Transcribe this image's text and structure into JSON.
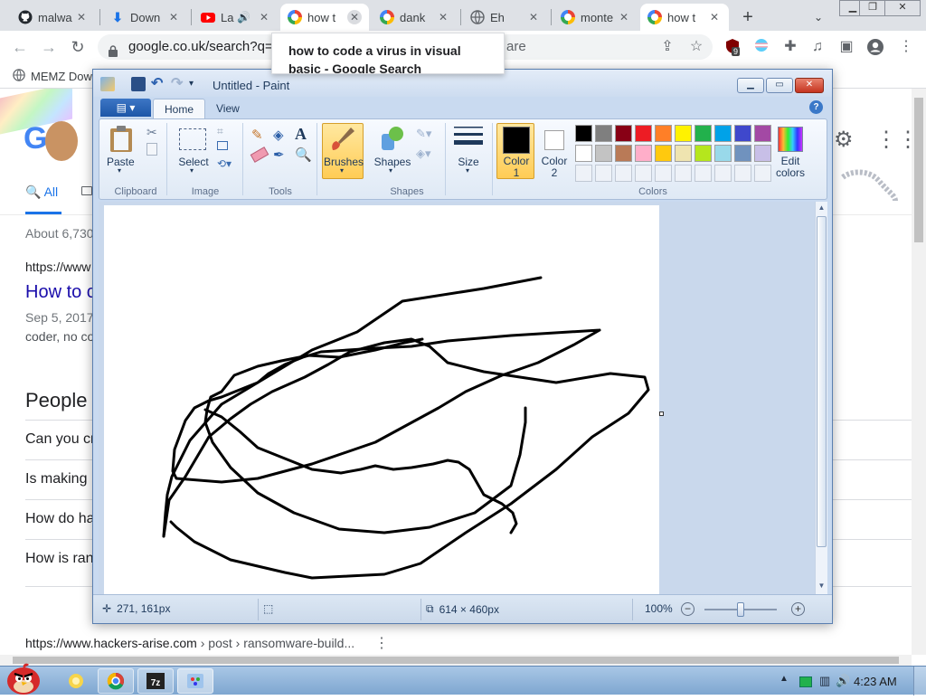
{
  "browser": {
    "tabs": [
      {
        "label": "malwa",
        "icon": "github-icon"
      },
      {
        "label": "Down",
        "icon": "download-icon"
      },
      {
        "label": "La",
        "icon": "youtube-icon"
      },
      {
        "label": "how t",
        "icon": "google-icon",
        "active": true
      },
      {
        "label": "dank",
        "icon": "google-icon"
      },
      {
        "label": "Eh",
        "icon": "globe-icon"
      },
      {
        "label": "monte",
        "icon": "google-icon"
      },
      {
        "label": "how t",
        "icon": "google-icon"
      }
    ],
    "new_tab_label": "+",
    "url": "google.co.uk/search?q=",
    "url_suffix": "are",
    "extension_badge": "9",
    "bookmark": "MEMZ Dow",
    "tooltip_title": "how to code a virus in visual basic - Google Search"
  },
  "google": {
    "logo_text": "Go",
    "tab_all": "All",
    "stats": "About 6,730",
    "result1_url": "https://www",
    "result1_title": "How to c",
    "result1_date": "Sep 5, 2017",
    "result1_snippet": "coder, no co",
    "paa_title": "People a",
    "paa_questions": [
      "Can you cr",
      "Is making",
      "How do ha",
      "How is ran"
    ],
    "result2_url": "https://www.hackers-arise.com",
    "result2_path": " › post › ransomware-build..."
  },
  "paint": {
    "title": "Untitled - Paint",
    "tabs": {
      "home": "Home",
      "view": "View"
    },
    "groups": {
      "clipboard": "Clipboard",
      "image": "Image",
      "tools": "Tools",
      "shapes": "Shapes",
      "colors": "Colors"
    },
    "buttons": {
      "paste": "Paste",
      "select": "Select",
      "brushes": "Brushes",
      "shapes": "Shapes",
      "size": "Size",
      "color1_line1": "Color",
      "color1_line2": "1",
      "color2_line1": "Color",
      "color2_line2": "2",
      "edit_colors_line1": "Edit",
      "edit_colors_line2": "colors"
    },
    "palette_row1": [
      "#000000",
      "#7f7f7f",
      "#880015",
      "#ed1c24",
      "#ff7f27",
      "#fff200",
      "#22b14c",
      "#00a2e8",
      "#3f48cc",
      "#a349a4"
    ],
    "palette_row2": [
      "#ffffff",
      "#c3c3c3",
      "#b97a57",
      "#ffaec9",
      "#ffc90e",
      "#efe4b0",
      "#b5e61d",
      "#99d9ea",
      "#7092be",
      "#c8bfe7"
    ],
    "color1": "#000000",
    "color2": "#ffffff",
    "status": {
      "cursor_pos": "271, 161px",
      "canvas_size": "614 × 460px",
      "zoom": "100%"
    }
  },
  "taskbar": {
    "clock": "4:23 AM"
  }
}
